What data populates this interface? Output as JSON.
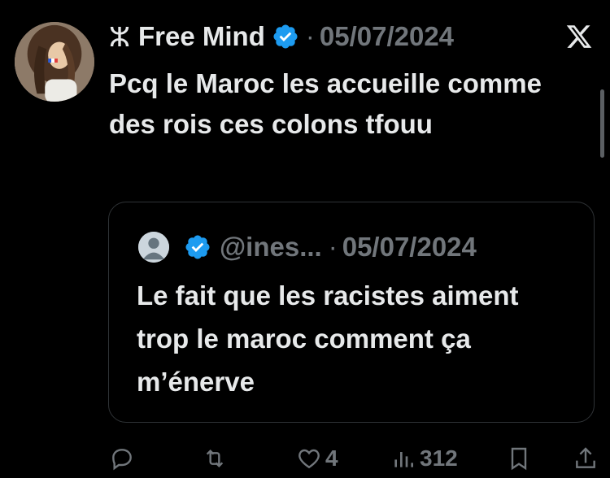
{
  "tweet": {
    "author_symbol": "ⵣ",
    "author_name": "Free Mind",
    "separator": "·",
    "date": "05/07/2024",
    "text": "Pcq le Maroc les accueille comme des rois ces colons tfouu",
    "avatar_icon": "user-avatar-photo"
  },
  "quoted": {
    "handle": "@ines...",
    "separator": "·",
    "date": "05/07/2024",
    "text": "Le fait que les racistes aiment trop le maroc comment ça m’énerve",
    "avatar_icon": "default-avatar-icon"
  },
  "actions": {
    "reply_count": "",
    "retweet_count": "",
    "like_count": "4",
    "views_count": "312"
  },
  "colors": {
    "background": "#000000",
    "text": "#e7e9ea",
    "muted": "#71767b",
    "verified_blue": "#1d9bf0",
    "border": "#2f3336"
  }
}
